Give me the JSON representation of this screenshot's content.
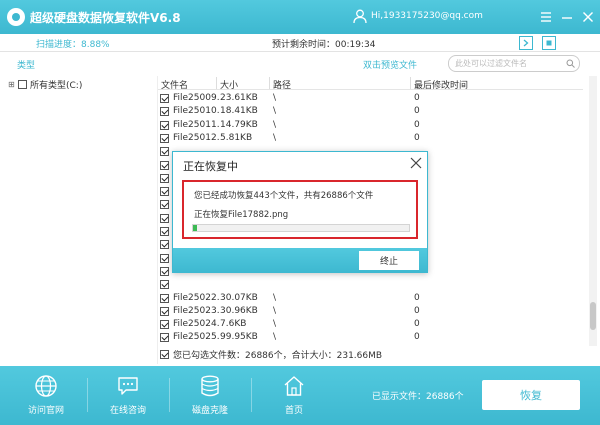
{
  "app": {
    "title": "超级硬盘数据恢复软件V6.8",
    "user": "Hi,1933175230@qq.com"
  },
  "scan": {
    "progress_label": "扫描进度：8.88%",
    "progress": 0.0888,
    "remaining_label": "预计剩余时间：00:19:34"
  },
  "toolbar": {
    "type_tab": "类型",
    "preview_label": "双击预览文件",
    "search_placeholder": "此处可以过滤文件名"
  },
  "tree": {
    "root_label": "所有类型(C:)"
  },
  "table": {
    "headers": {
      "name": "文件名",
      "size": "大小",
      "path": "路径",
      "modified": "最后修改时间"
    },
    "rows": [
      {
        "name": "File25009...",
        "size": "23.61KB",
        "path": "\\",
        "date": "0"
      },
      {
        "name": "File25010...",
        "size": "18.41KB",
        "path": "\\",
        "date": "0"
      },
      {
        "name": "File25011...",
        "size": "14.79KB",
        "path": "\\",
        "date": "0"
      },
      {
        "name": "File25012...",
        "size": "5.81KB",
        "path": "\\",
        "date": "0"
      },
      {
        "name": "",
        "size": "",
        "path": "",
        "date": ""
      },
      {
        "name": "",
        "size": "",
        "path": "",
        "date": ""
      },
      {
        "name": "",
        "size": "",
        "path": "",
        "date": ""
      },
      {
        "name": "",
        "size": "",
        "path": "",
        "date": ""
      },
      {
        "name": "",
        "size": "",
        "path": "",
        "date": ""
      },
      {
        "name": "",
        "size": "",
        "path": "",
        "date": ""
      },
      {
        "name": "",
        "size": "",
        "path": "",
        "date": ""
      },
      {
        "name": "",
        "size": "",
        "path": "",
        "date": ""
      },
      {
        "name": "",
        "size": "",
        "path": "",
        "date": ""
      },
      {
        "name": "",
        "size": "",
        "path": "",
        "date": ""
      },
      {
        "name": "",
        "size": "",
        "path": "",
        "date": ""
      },
      {
        "name": "File25022...",
        "size": "30.07KB",
        "path": "\\",
        "date": "0"
      },
      {
        "name": "File25023...",
        "size": "30.96KB",
        "path": "\\",
        "date": "0"
      },
      {
        "name": "File25024...",
        "size": "7.6KB",
        "path": "\\",
        "date": "0"
      },
      {
        "name": "File25025...",
        "size": "99.95KB",
        "path": "\\",
        "date": "0"
      },
      {
        "name": "File25026...",
        "size": "78.45KB",
        "path": "\\",
        "date": "0"
      }
    ]
  },
  "summary": {
    "text": "您已勾选文件数：26886个，合计大小：231.66MB"
  },
  "bottom": {
    "nav": [
      {
        "label": "访问官网"
      },
      {
        "label": "在线咨询"
      },
      {
        "label": "磁盘克隆"
      },
      {
        "label": "首页"
      }
    ],
    "shown_files": "已显示文件：26886个",
    "recover_label": "恢复"
  },
  "dialog": {
    "title": "正在恢复中",
    "message": "您已经成功恢复443个文件，共有26886个文件",
    "current": "正在恢复File17882.png",
    "progress": 0.0165,
    "stop_label": "终止"
  },
  "colors": {
    "accent": "#3db8d0",
    "highlight_border": "#d9262c",
    "progress_fill": "#3cba54"
  }
}
